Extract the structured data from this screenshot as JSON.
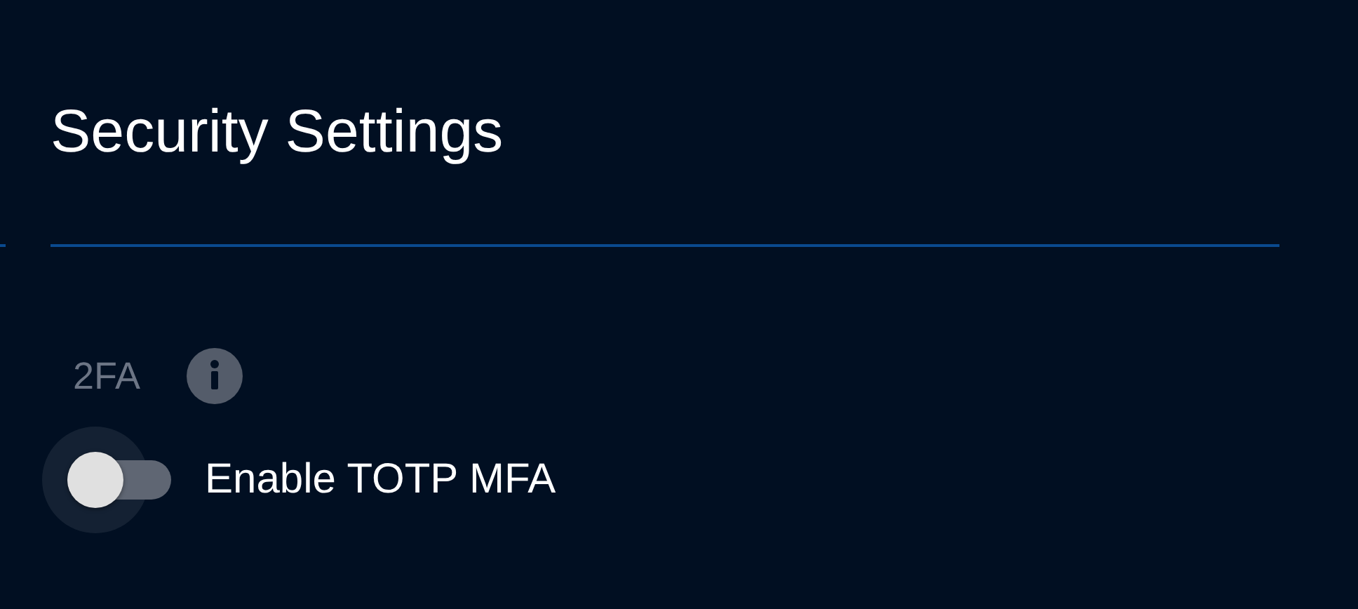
{
  "title": "Security Settings",
  "section": {
    "label": "2FA"
  },
  "toggle": {
    "label": "Enable TOTP MFA",
    "on": false
  }
}
